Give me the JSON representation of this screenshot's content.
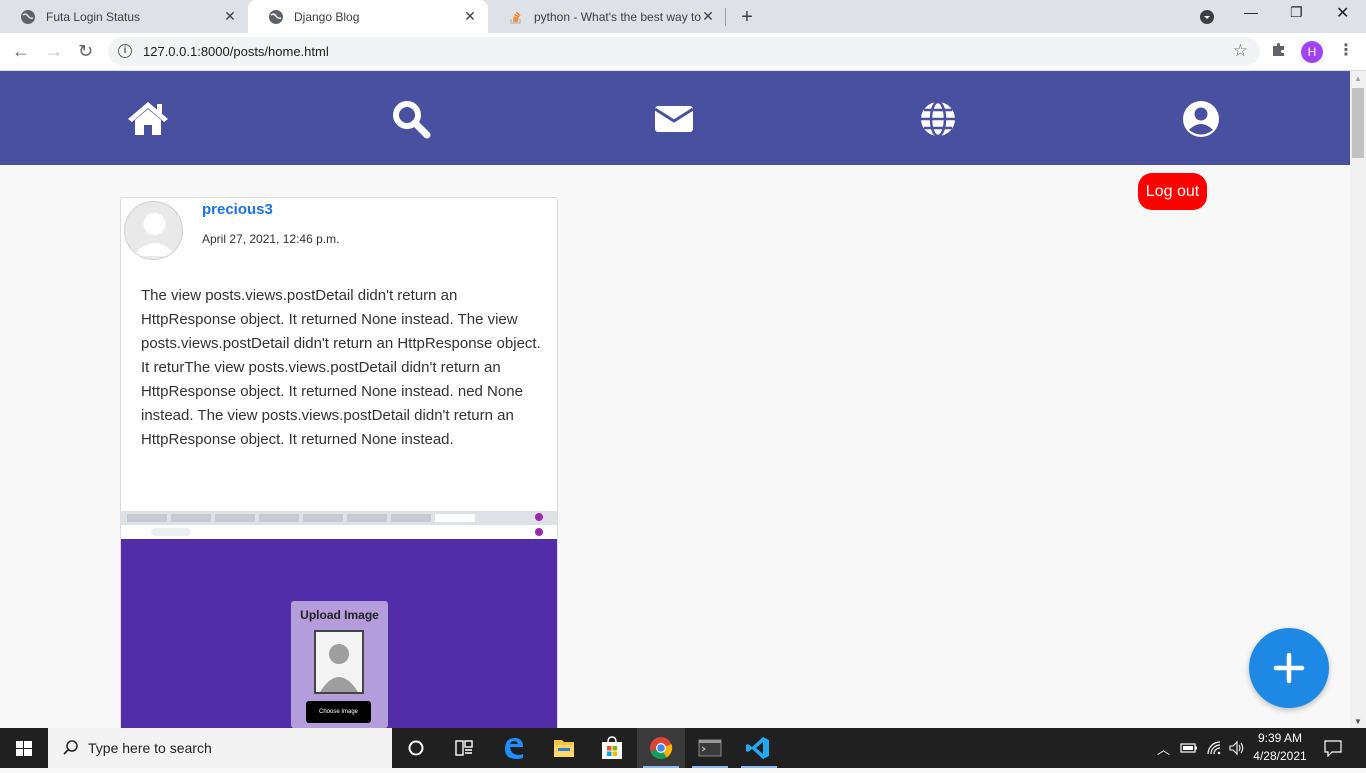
{
  "browser": {
    "tabs": [
      {
        "title": "Futa Login Status",
        "icon": "globe-icon"
      },
      {
        "title": "Django Blog",
        "icon": "globe-icon",
        "active": true
      },
      {
        "title": "python - What's the best way to",
        "icon": "stackoverflow-icon"
      }
    ],
    "url": "127.0.0.1:8000/posts/home.html",
    "profile_initial": "H",
    "profile_color": "#a142f4"
  },
  "page": {
    "nav_icons": [
      "home-icon",
      "search-icon",
      "mail-icon",
      "globe-icon",
      "user-icon"
    ],
    "nav_color": "#4a50a0",
    "logout_label": "Log out",
    "logout_color": "#ff0000",
    "post": {
      "author": "precious3",
      "date": "April 27, 2021, 12:46 p.m.",
      "body": "The view posts.views.postDetail didn't return an HttpResponse object. It returned None instead. The view posts.views.postDetail didn't return an HttpResponse object. It returThe view posts.views.postDetail didn't return an HttpResponse object. It returned None instead. ned None instead. The view posts.views.postDetail didn't return an HttpResponse object. It returned None instead.",
      "image": {
        "upload_title": "Upload Image",
        "choose_label": "Choose Image"
      }
    },
    "fab_color": "#1e88e5"
  },
  "taskbar": {
    "search_placeholder": "Type here to search",
    "time": "9:39 AM",
    "date": "4/28/2021"
  }
}
